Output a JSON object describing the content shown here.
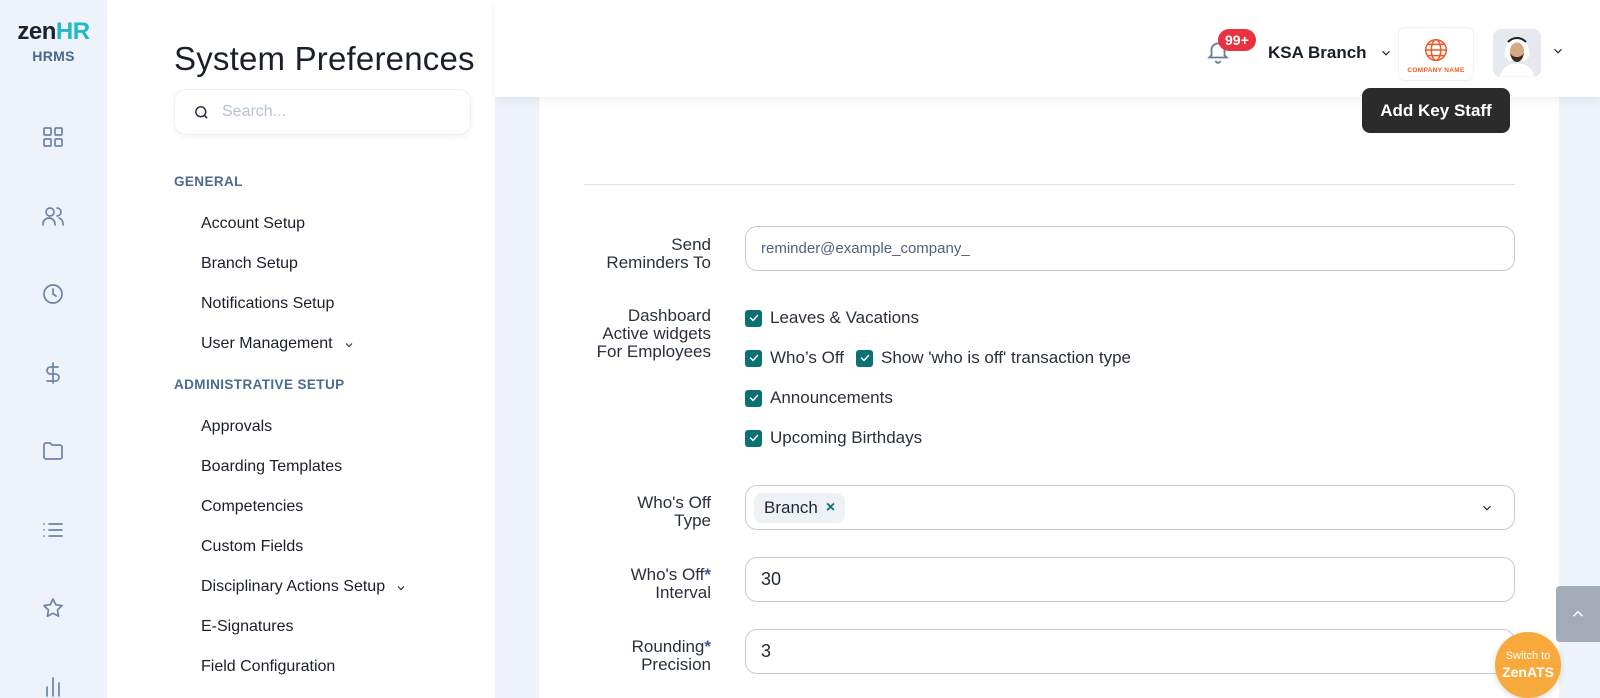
{
  "app": {
    "brand_zen": "zen",
    "brand_hr": "HR",
    "brand_sub": "HRMS"
  },
  "rail_icons": [
    "dashboard-icon",
    "people-icon",
    "clock-icon",
    "dollar-icon",
    "folder-icon",
    "list-icon",
    "star-icon",
    "chart-icon"
  ],
  "sidebar": {
    "title": "System Preferences",
    "search_placeholder": "Search...",
    "sections": [
      {
        "heading": "GENERAL",
        "items": [
          {
            "label": "Account Setup"
          },
          {
            "label": "Branch Setup"
          },
          {
            "label": "Notifications Setup"
          },
          {
            "label": "User Management",
            "expandable": true
          }
        ]
      },
      {
        "heading": "ADMINISTRATIVE SETUP",
        "items": [
          {
            "label": "Approvals"
          },
          {
            "label": "Boarding Templates"
          },
          {
            "label": "Competencies"
          },
          {
            "label": "Custom Fields"
          },
          {
            "label": "Disciplinary Actions Setup",
            "expandable": true
          },
          {
            "label": "E-Signatures"
          },
          {
            "label": "Field Configuration"
          }
        ]
      }
    ]
  },
  "header": {
    "notification_count": "99+",
    "branch_label": "KSA Branch",
    "company_logo_text": "COMPANY NAME"
  },
  "main": {
    "add_key_staff_label": "Add Key Staff",
    "send_reminders": {
      "label_line1": "Send",
      "label_line2": "Reminders To",
      "value": "reminder@example_company_"
    },
    "dashboard_widgets": {
      "label_line1": "Dashboard",
      "label_line2": "Active widgets",
      "label_line3": "For Employees",
      "options": [
        {
          "label": "Leaves & Vacations",
          "checked": true
        },
        {
          "label": "Who’s Off",
          "checked": true
        },
        {
          "label": "Show 'who is off' transaction type",
          "checked": true
        },
        {
          "label": "Announcements",
          "checked": true
        },
        {
          "label": "Upcoming Birthdays",
          "checked": true
        }
      ]
    },
    "whos_off_type": {
      "label_line1": "Who's Off",
      "label_line2": "Type",
      "selected_chip": "Branch",
      "chip_remove": "×"
    },
    "whos_off_interval": {
      "label_line1": "Who's Off",
      "label_line2": "Interval",
      "required_mark": "*",
      "value": "30"
    },
    "rounding_precision": {
      "label_line1": "Rounding",
      "label_line2": "Precision",
      "required_mark": "*",
      "value": "3"
    }
  },
  "switch_button": {
    "line1": "Switch to",
    "line2": "ZenATS"
  },
  "colors": {
    "accent_teal": "#0d7173",
    "brand_cyan": "#22b8c8",
    "badge_red": "#e8323f",
    "switch_orange": "#f7a93b",
    "section_blue": "#4c6994"
  }
}
